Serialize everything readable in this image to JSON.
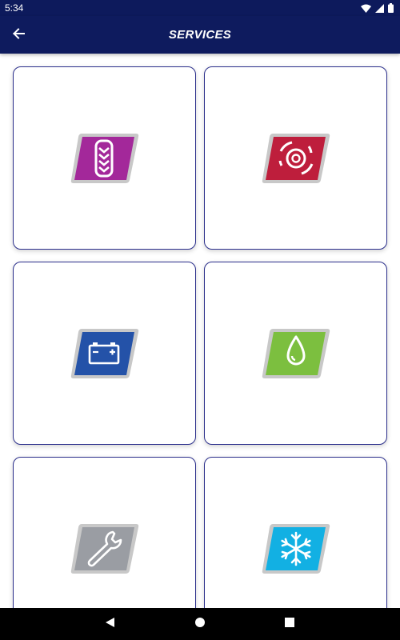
{
  "status_bar": {
    "time": "5:34"
  },
  "app_bar": {
    "title": "SERVICES"
  },
  "services": [
    {
      "icon": "tire-tread-icon",
      "color": "#a3289a"
    },
    {
      "icon": "brake-disc-icon",
      "color": "#be1e3c"
    },
    {
      "icon": "battery-icon",
      "color": "#2452a8"
    },
    {
      "icon": "oil-drop-icon",
      "color": "#7cbf3f"
    },
    {
      "icon": "wrench-icon",
      "color": "#9a9da3"
    },
    {
      "icon": "snowflake-icon",
      "color": "#12b0e3"
    }
  ],
  "colors": {
    "header": "#0e1b5e",
    "tile_border": "#2b2f8c",
    "badge_rim": "#c8c8c8"
  }
}
